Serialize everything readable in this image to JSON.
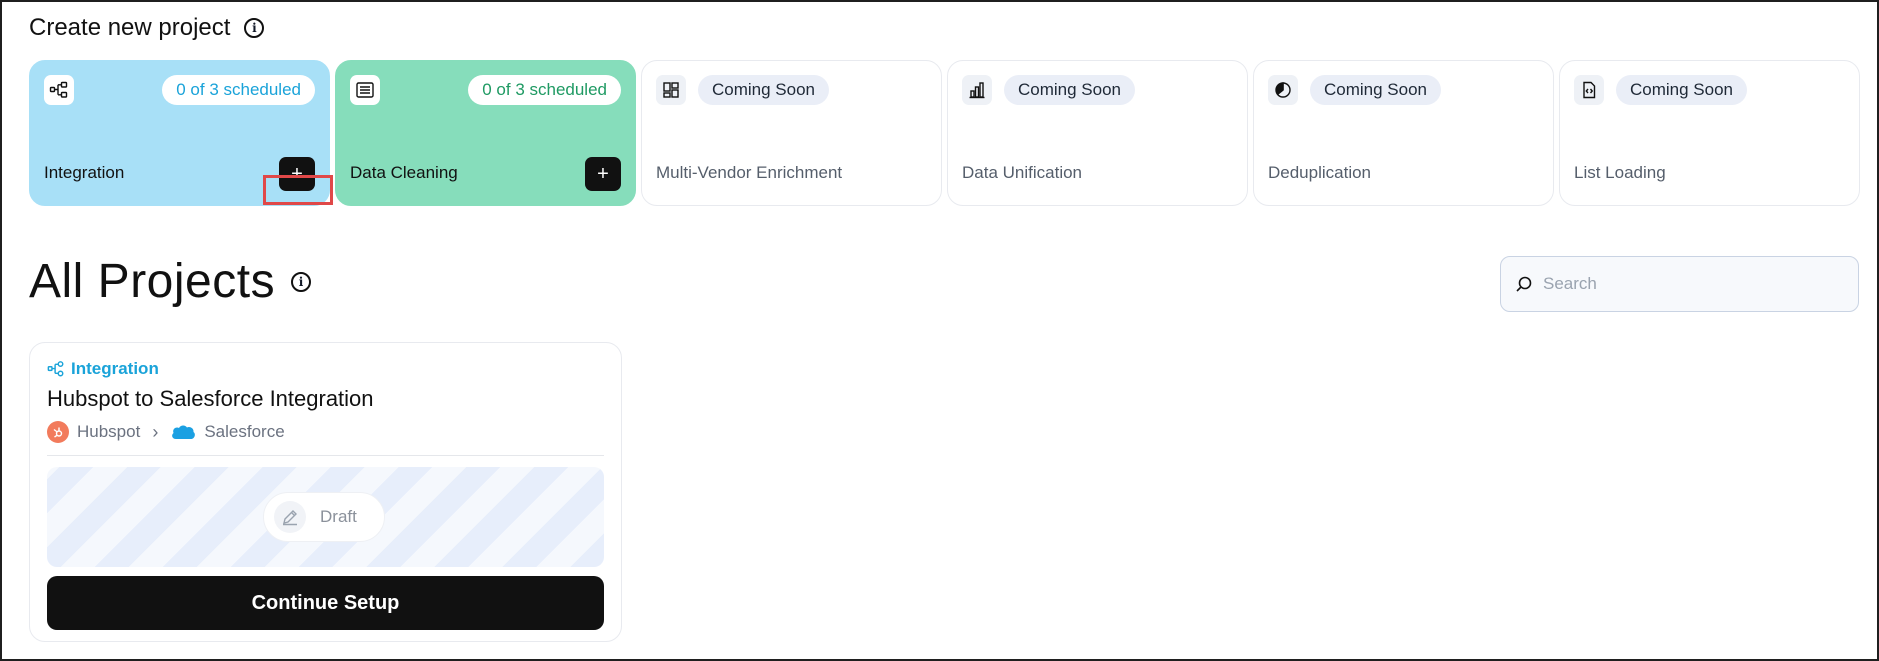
{
  "header": {
    "title": "Create new project"
  },
  "project_types": [
    {
      "key": "integration",
      "label": "Integration",
      "badge": "0 of 3 scheduled",
      "icon": "integration-icon",
      "add": "+"
    },
    {
      "key": "cleaning",
      "label": "Data Cleaning",
      "badge": "0 of 3 scheduled",
      "icon": "list-icon",
      "add": "+"
    },
    {
      "key": "enrichment",
      "label": "Multi-Vendor Enrichment",
      "badge": "Coming Soon",
      "icon": "grid-icon"
    },
    {
      "key": "unification",
      "label": "Data Unification",
      "badge": "Coming Soon",
      "icon": "bar-chart-icon"
    },
    {
      "key": "dedup",
      "label": "Deduplication",
      "badge": "Coming Soon",
      "icon": "pie-chart-icon"
    },
    {
      "key": "listloading",
      "label": "List Loading",
      "badge": "Coming Soon",
      "icon": "code-file-icon"
    }
  ],
  "all_projects": {
    "title": "All Projects",
    "search": {
      "placeholder": "Search",
      "value": ""
    }
  },
  "project": {
    "type": "Integration",
    "title": "Hubspot to Salesforce Integration",
    "source": "Hubspot",
    "destination": "Salesforce",
    "status": "Draft",
    "action": "Continue Setup"
  },
  "colors": {
    "integration_card": "#a8e0f7",
    "cleaning_card": "#86ddbb",
    "integration_accent": "#1aa3d9",
    "cleaning_accent": "#1f9a63",
    "highlight": "#e04848"
  }
}
